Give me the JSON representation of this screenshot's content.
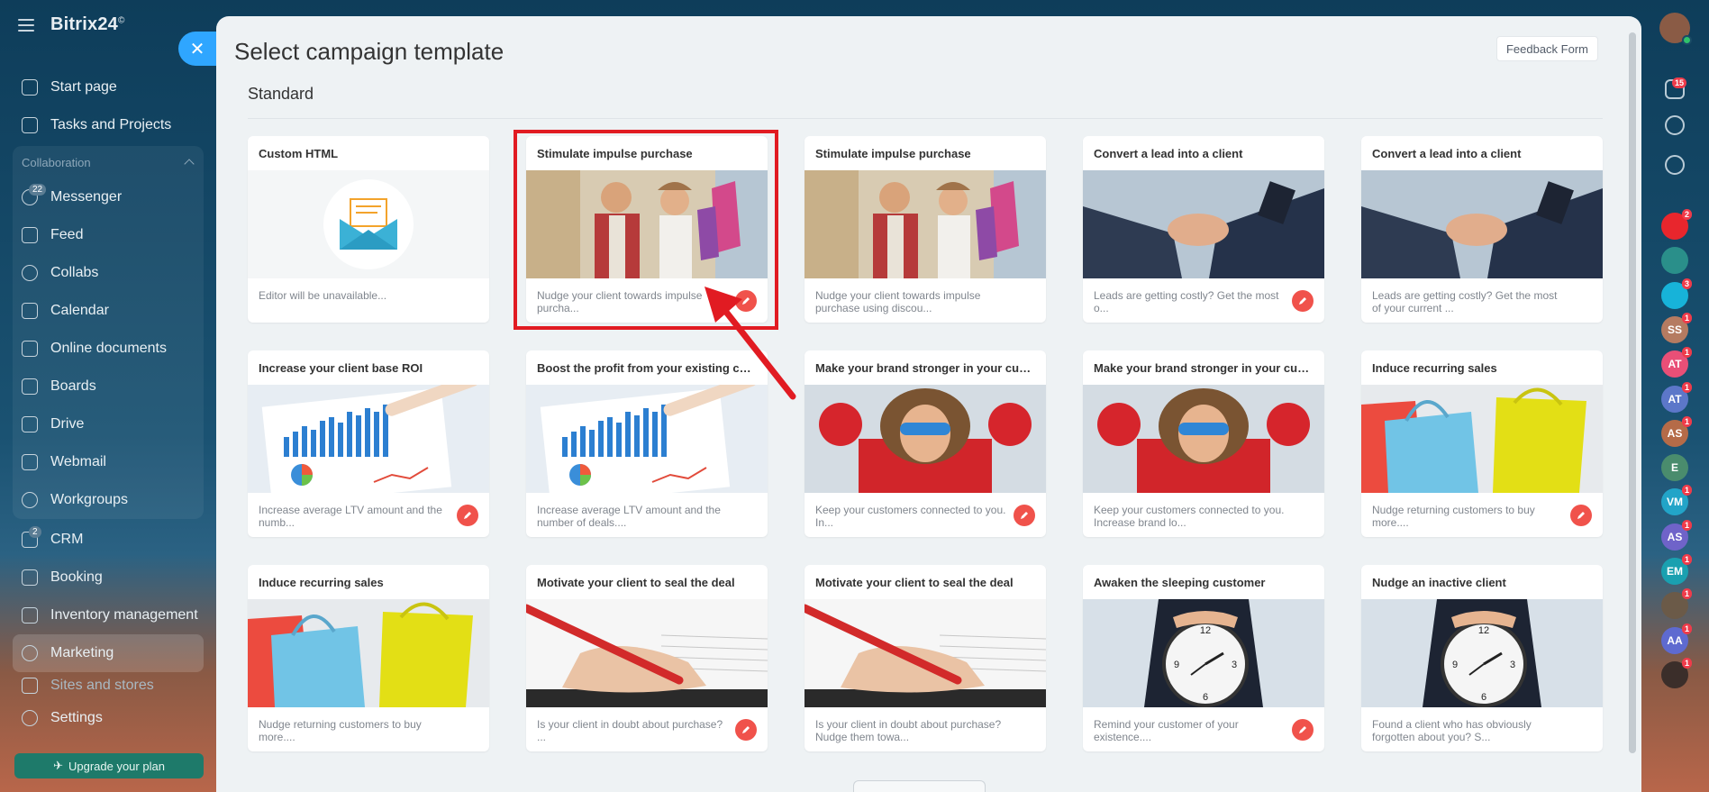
{
  "sidebar": {
    "logo": "Bitrix24",
    "logo_mark": "©",
    "items": [
      {
        "label": "Start page"
      },
      {
        "label": "Tasks and Projects"
      }
    ],
    "collab_header": "Collaboration",
    "collab_items": [
      {
        "label": "Messenger",
        "badge": "22"
      },
      {
        "label": "Feed"
      },
      {
        "label": "Collabs"
      },
      {
        "label": "Calendar"
      },
      {
        "label": "Online documents"
      },
      {
        "label": "Boards"
      },
      {
        "label": "Drive"
      },
      {
        "label": "Webmail"
      },
      {
        "label": "Workgroups"
      }
    ],
    "more_items": [
      {
        "label": "CRM",
        "badge": "2"
      },
      {
        "label": "Booking"
      },
      {
        "label": "Inventory management"
      },
      {
        "label": "Marketing"
      },
      {
        "label": "Sites and stores"
      },
      {
        "label": "Settings"
      }
    ],
    "upgrade_label": "Upgrade your plan",
    "close_glyph": "✕"
  },
  "panel": {
    "title": "Select campaign template",
    "feedback_label": "Feedback Form",
    "section_title": "Standard"
  },
  "templates": [
    {
      "title": "Custom HTML",
      "desc": "Editor will be unavailable...",
      "img": "html"
    },
    {
      "title": "Stimulate impulse purchase",
      "desc": "Nudge your client towards impulse purcha...",
      "img": "impulse"
    },
    {
      "title": "Stimulate impulse purchase",
      "desc": "Nudge your client towards impulse purchase using discou...",
      "img": "impulse"
    },
    {
      "title": "Convert a lead into a client",
      "desc": "Leads are getting costly? Get the most o...",
      "img": "hands"
    },
    {
      "title": "Convert a lead into a client",
      "desc": "Leads are getting costly? Get the most of your current ...",
      "img": "hands"
    },
    {
      "title": "Increase your client base ROI",
      "desc": "Increase average LTV amount and the numb...",
      "img": "chart"
    },
    {
      "title": "Boost the profit from your existing custom...",
      "desc": "Increase average LTV amount and the number of deals....",
      "img": "chart"
    },
    {
      "title": "Make your brand stronger in your custome...",
      "desc": "Keep your customers connected to you. In...",
      "img": "hero"
    },
    {
      "title": "Make your brand stronger in your custome...",
      "desc": "Keep your customers connected to you. Increase brand lo...",
      "img": "hero"
    },
    {
      "title": "Induce recurring sales",
      "desc": "Nudge returning customers to buy more....",
      "img": "bags"
    },
    {
      "title": "Induce recurring sales",
      "desc": "Nudge returning customers to buy more....",
      "img": "bags"
    },
    {
      "title": "Motivate your client to seal the deal",
      "desc": "Is your client in doubt about purchase? ...",
      "img": "pen"
    },
    {
      "title": "Motivate your client to seal the deal",
      "desc": "Is your client in doubt about purchase? Nudge them towa...",
      "img": "pen"
    },
    {
      "title": "Awaken the sleeping customer",
      "desc": "Remind your customer of your existence....",
      "img": "clock"
    },
    {
      "title": "Nudge an inactive client",
      "desc": "Found a client who has obviously forgotten about you? S...",
      "img": "clock"
    }
  ],
  "rightbar": {
    "notifications_badge": "15",
    "contacts": [
      {
        "initials": "",
        "badge": "2",
        "color": "#e8262d"
      },
      {
        "initials": "",
        "badge": "",
        "color": "#2a8f8a"
      },
      {
        "initials": "",
        "badge": "3",
        "color": "#17b3d9"
      },
      {
        "initials": "SS",
        "badge": "1",
        "color": "#b57b61"
      },
      {
        "initials": "AT",
        "badge": "1",
        "color": "#e94f77"
      },
      {
        "initials": "AT",
        "badge": "1",
        "color": "#5c77c9"
      },
      {
        "initials": "AS",
        "badge": "1",
        "color": "#b56b48"
      },
      {
        "initials": "E",
        "badge": "",
        "color": "#4a8c6d"
      },
      {
        "initials": "VM",
        "badge": "1",
        "color": "#22a4c8"
      },
      {
        "initials": "AS",
        "badge": "1",
        "color": "#6f63c9"
      },
      {
        "initials": "EM",
        "badge": "1",
        "color": "#1aa0b0"
      },
      {
        "initials": "",
        "badge": "1",
        "color": "#6b5a48"
      },
      {
        "initials": "AA",
        "badge": "1",
        "color": "#5e6ad0"
      },
      {
        "initials": "",
        "badge": "1",
        "color": "#3b2e2a"
      }
    ]
  },
  "colors": {
    "accent": "#2fa6ff",
    "pen_button": "#f0524b",
    "highlight": "#e11b22"
  }
}
